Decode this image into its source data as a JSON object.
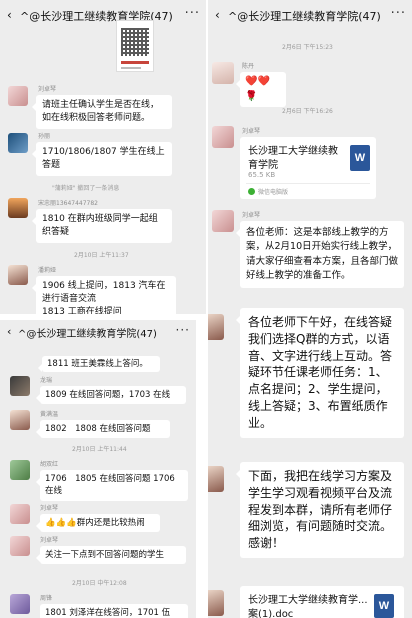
{
  "p1": {
    "back": "‹",
    "title": "^@长沙理工继续教育学院(47)",
    "more": "···",
    "msgs": [
      {
        "name": "刘卓琴",
        "text": "请班主任确认学生是否在线，如在线积极回答老师问题。"
      },
      {
        "name": "孙丽",
        "text": "1710/1806/1807 学生在线上答题"
      },
      {
        "notice": "\"蒲莉娅\" 撤回了一条消息"
      },
      {
        "name": "宋忠丽13647447782",
        "text": "1810 在群内班级同学一起组织答疑"
      },
      {
        "time": "2月10日 上午11:37"
      },
      {
        "name": "潘莉娅",
        "text": "1906 线上提问，1813 汽车在进行语音交流\n1813 工商在线提问"
      }
    ]
  },
  "p2": {
    "back": "‹",
    "title": "^@长沙理工继续教育学院(47)",
    "more": "···",
    "time1": "2月6日 下午15:23",
    "user1": "陈丹",
    "emoji": "❤️❤️🌹",
    "time2": "2月6日 下午16:26",
    "user2": "刘卓琴",
    "file1": {
      "name": "长沙理工大学继续教育学院",
      "size": "65.5 KB",
      "source": "微信电脑版",
      "icon": "W"
    },
    "user3": "刘卓琴",
    "notice": "各位老师：这是本部线上教学的方案，从2月10日开始实行线上教学，请大家仔细查看本方案，且各部门做好线上教学的准备工作。",
    "msg_big1": "各位老师下午好，在线答疑我们选择Q群的方式，以语音、文字进行线上互动。答疑环节任课老师任务：1、点名提问；2、学生提问，线上答疑；3、布置纸质作业。",
    "msg_big2": "下面，我把在线学习方案及学生学习观看视频平台及流程发到本群，请所有老师仔细浏览，有问题随时交流。感谢！",
    "file2": {
      "name": "长沙理工大学继续教育学...案(1).doc",
      "icon": "W"
    }
  },
  "p3": {
    "back": "‹",
    "title": "^@长沙理工继续教育学院(47)",
    "more": "···",
    "msgs": [
      {
        "text": "1811 班王美霖线上答问。"
      },
      {
        "name": "龙瑞",
        "text": "1809 在线回答问题，1703 在线"
      },
      {
        "name": "黄满温",
        "text": "1802　1808 在线回答问题"
      },
      {
        "time": "2月10日 上午11:44"
      },
      {
        "name": "胡双红",
        "text": "1706　1805 在线回答问题 1706 在线"
      },
      {
        "name": "刘卓琴",
        "text": "👍👍👍群内还是比较热闹"
      },
      {
        "name": "刘卓琴",
        "text": "关注一下点到不回答问题的学生"
      },
      {
        "time": "2月10日 中午12:08"
      },
      {
        "name": "周锋",
        "text": "1801 刘泽洋在线答问，1701 伍"
      }
    ]
  }
}
